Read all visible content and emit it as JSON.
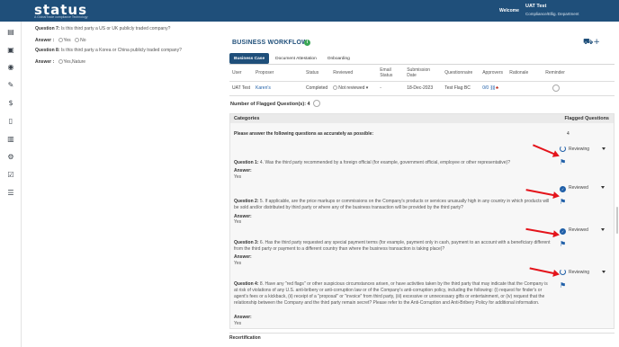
{
  "header": {
    "logo": "status",
    "logo_sub": "A GlobalTrade compliance Technology",
    "welcome": "Welcome",
    "user_name": "UAT Test",
    "user_role": "Compliance/Ellig. Department"
  },
  "left_questions": [
    {
      "question": "Question 7:",
      "text": "Is this third party a US or UK publicly traded company?",
      "answer_label": "Answer :",
      "options": [
        "Yes",
        "No"
      ]
    },
    {
      "question": "Question 8:",
      "text": "Is this third party a Korea or China publicly traded company?",
      "answer_label": "Answer :",
      "options": [
        "Yes,Nature"
      ]
    }
  ],
  "card": {
    "title": "BUSINESS WORKFLOW",
    "tabs": [
      "Business Case",
      "Document Attestation",
      "Onboarding"
    ],
    "columns": [
      "User",
      "Proposer",
      "Status",
      "Reviewed",
      "Email Status",
      "Submission Date",
      "Questionnaire",
      "Approvers",
      "Rationale",
      "Reminder"
    ],
    "row": {
      "user": "UAT Test",
      "proposer": "Karen's",
      "status": "Completed",
      "reviewed": "Not reviewed",
      "email_status": "-",
      "submission_date": "18-Dec-2023",
      "questionnaire": "Test Flag BC",
      "approvers": "0/0"
    }
  },
  "flagged": {
    "label": "Number of Flagged Question(s): 4",
    "cat_header": "Categories",
    "flag_header": "Flagged Questions",
    "intro": "Please answer the following questions as accurately as possible:",
    "count": "4",
    "answer_label": "Answer:",
    "questions": [
      {
        "num": "Question 1:",
        "text": "4. Was the third party recommended by a foreign official (for example, government official, employee or other representative)?",
        "answer": "Yes",
        "status": "Reviewing"
      },
      {
        "num": "Question 2:",
        "text": "5. If applicable, are the price markups or commissions on the Company's products or services unusually high in any country in which products will be sold and/or distributed by third party or where any of the business transaction will be provided by the third party?",
        "answer": "Yes",
        "status": "Reviewed"
      },
      {
        "num": "Question 3:",
        "text": "6. Has the third party requested any special payment terms (for example, payment only in cash, payment to an account with a beneficiary different from the third party or payment to a different country than where the business transaction is taking place)?",
        "answer": "Yes",
        "status": "Reviewed"
      },
      {
        "num": "Question 4:",
        "text": "8. Have any \"red flags\" or other suspicious circumstances arisen, or have activities taken by the third party that may indicate that the Company is at risk of violations of any U.S. anti-bribery or anti-corruption law or of the Company's anti-corruption policy, including the following: (i) request for finder's or agent's fees or a kickback, (ii) receipt of a \"proposal\" or \"invoice\" from third party, (iii) excessive or unnecessary gifts or entertainment, or (iv) request that the relationship between the Company and the third party remain secret? Please refer to the Anti-Corruption and Anti-Bribery Policy for additional information.",
        "answer": "Yes",
        "status": "Reviewing"
      }
    ]
  },
  "recertification": "Recertification",
  "colors": {
    "brand": "#1f4f7a",
    "arrow": "#e4141b",
    "reviewed": "#1f5fa8"
  }
}
